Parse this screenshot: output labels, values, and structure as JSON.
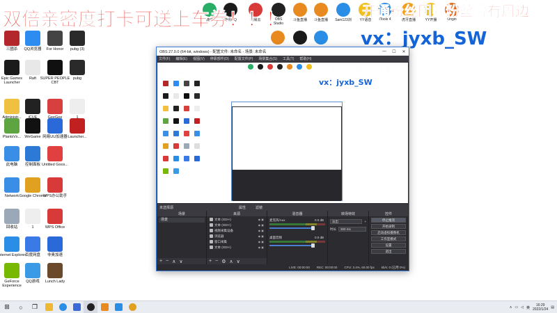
{
  "overlay": {
    "main_text": "双倍亲密度打卡可送上车券！！！",
    "top_right_text": "开通粉丝团赠粉丝牌有周边",
    "contact": "vx：jyxb_SW",
    "obs_overlay_text": "双倍亲密度打卡可送上车券！！！开通粉丝团赠粉丝牌有周边",
    "obs_contact": "vx：jyxb_SW"
  },
  "desktop": {
    "icons": [
      {
        "label": "三國杀",
        "color": "#b3262b"
      },
      {
        "label": "QQ浏览器",
        "color": "#2d8cf0"
      },
      {
        "label": "For Honor",
        "color": "#444"
      },
      {
        "label": "pubg (3)",
        "color": "#2a2a2a"
      },
      {
        "label": "Epic Games Launcher",
        "color": "#1b1b1b"
      },
      {
        "label": "Raft",
        "color": "#e8e8e8"
      },
      {
        "label": "SUPER PEOPLE CBT",
        "color": "#101010"
      },
      {
        "label": "pubg",
        "color": "#2a2a2a"
      },
      {
        "label": "Administr...",
        "color": "#f0c040"
      },
      {
        "label": "iCUE",
        "color": "#222"
      },
      {
        "label": "GeeGee",
        "color": "#d84040"
      },
      {
        "label": "1",
        "color": "#eee"
      },
      {
        "label": "PlantsVs...",
        "color": "#5ea542"
      },
      {
        "label": "WeGame",
        "color": "#111"
      },
      {
        "label": "网易UU加速器",
        "color": "#2a6ad8"
      },
      {
        "label": "Launcher...",
        "color": "#c02020"
      },
      {
        "label": "此电脑",
        "color": "#3a8ee6"
      },
      {
        "label": "控制面板",
        "color": "#2d7ad6"
      },
      {
        "label": "Untitled Goos...",
        "color": "#e04040"
      },
      {
        "label": "Network",
        "color": "#3a8ee6"
      },
      {
        "label": "Google Chrome",
        "color": "#e0a020"
      },
      {
        "label": "WPS办公助手",
        "color": "#d83a3a"
      },
      {
        "label": "回收站",
        "color": "#9aa8b8"
      },
      {
        "label": "1",
        "color": "#eee"
      },
      {
        "label": "WPS Office",
        "color": "#d83a3a"
      },
      {
        "label": "Internet Explorer",
        "color": "#2a8ee6"
      },
      {
        "label": "百度网盘",
        "color": "#3a7ae6"
      },
      {
        "label": "非奥加速",
        "color": "#2a6ad8"
      },
      {
        "label": "GeForce Experience",
        "color": "#76b900"
      },
      {
        "label": "QQ游戏",
        "color": "#3a9ae6"
      },
      {
        "label": "Lunch Lady",
        "color": "#6a4a2a"
      }
    ],
    "top_icons": [
      {
        "label": "微信",
        "color": "#2aae67"
      },
      {
        "label": "腾讯QQ",
        "color": "#1a1a1a"
      },
      {
        "label": "网易云",
        "color": "#d83a3a"
      },
      {
        "label": "OBS Studio",
        "color": "#222"
      },
      {
        "label": "斗鱼直播",
        "color": "#e88a20"
      },
      {
        "label": "斗鱼直播",
        "color": "#e88a20"
      },
      {
        "label": "Sam123浏",
        "color": "#2a8ee6"
      },
      {
        "label": "YY语音",
        "color": "#f0c020"
      },
      {
        "label": "iTools 4",
        "color": "#2a8ee6"
      },
      {
        "label": "虎牙直播",
        "color": "#f0a020"
      },
      {
        "label": "YY开播",
        "color": "#f0c020"
      },
      {
        "label": "Origin",
        "color": "#e06a20"
      }
    ]
  },
  "obs": {
    "title": "OBS 27.0.0 (64-bit, windows) - 配置文件: 未命名 - 场景: 未命名",
    "menu": [
      "文件(F)",
      "编辑(E)",
      "视图(V)",
      "停靠部件(D)",
      "配置文件(P)",
      "场景集合(S)",
      "工具(T)",
      "帮助(H)"
    ],
    "no_source": "未选择源",
    "props_btn": "属性",
    "filters_btn": "滤镜",
    "docks": {
      "scenes": "场景",
      "sources": "来源",
      "mixer": "混音器",
      "transitions": "转场特效",
      "controls": "控件"
    },
    "scene_items": [
      "场景"
    ],
    "source_items": [
      "文本 (GDI+)",
      "文本 (GDI+)",
      "视频采集设备",
      "浏览器",
      "窗口采集",
      "文本 (GDI+)"
    ],
    "mixer_channels": [
      {
        "name": "麦克风/Aux",
        "db": "0.0 dB"
      },
      {
        "name": "桌面音频",
        "db": "0.0 dB"
      }
    ],
    "transition": {
      "type": "淡出",
      "duration_label": "时长",
      "duration": "300 ms"
    },
    "controls": [
      "停止推流",
      "开始录制",
      "启动虚拟摄像机",
      "工作室模式",
      "设置",
      "退出"
    ],
    "status": [
      "LIVE: 00:00:00",
      "REC: 00:00:00",
      "CPU: 3.4%, 60.00 fps",
      "kb/s: 0 (已用 0%)"
    ]
  },
  "taskbar": {
    "time": "16:29",
    "date": "2022/1/24",
    "lang": "英"
  }
}
